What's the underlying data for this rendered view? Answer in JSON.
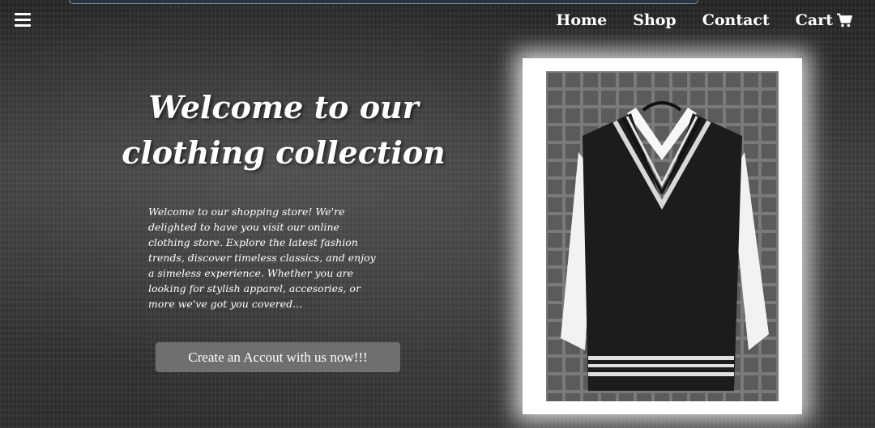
{
  "nav": {
    "items": [
      "Home",
      "Shop",
      "Contact"
    ],
    "cart_label": "Cart"
  },
  "hero": {
    "title_line1": "Welcome to our",
    "title_line2": "clothing collection",
    "description": "Welcome to our shopping store! We're delighted to have you visit our online clothing store. Explore the latest fashion trends, discover timeless classics, and enjoy a simeless experience. Whether you are looking for stylish apparel, accesories, or more we've got you covered...",
    "cta_label": "Create an Accout with us now!!!"
  },
  "colors": {
    "text": "#ffffff",
    "button_bg": "#6f6f6f",
    "frame": "#ffffff"
  },
  "icons": [
    "menu-icon",
    "cart-icon"
  ]
}
